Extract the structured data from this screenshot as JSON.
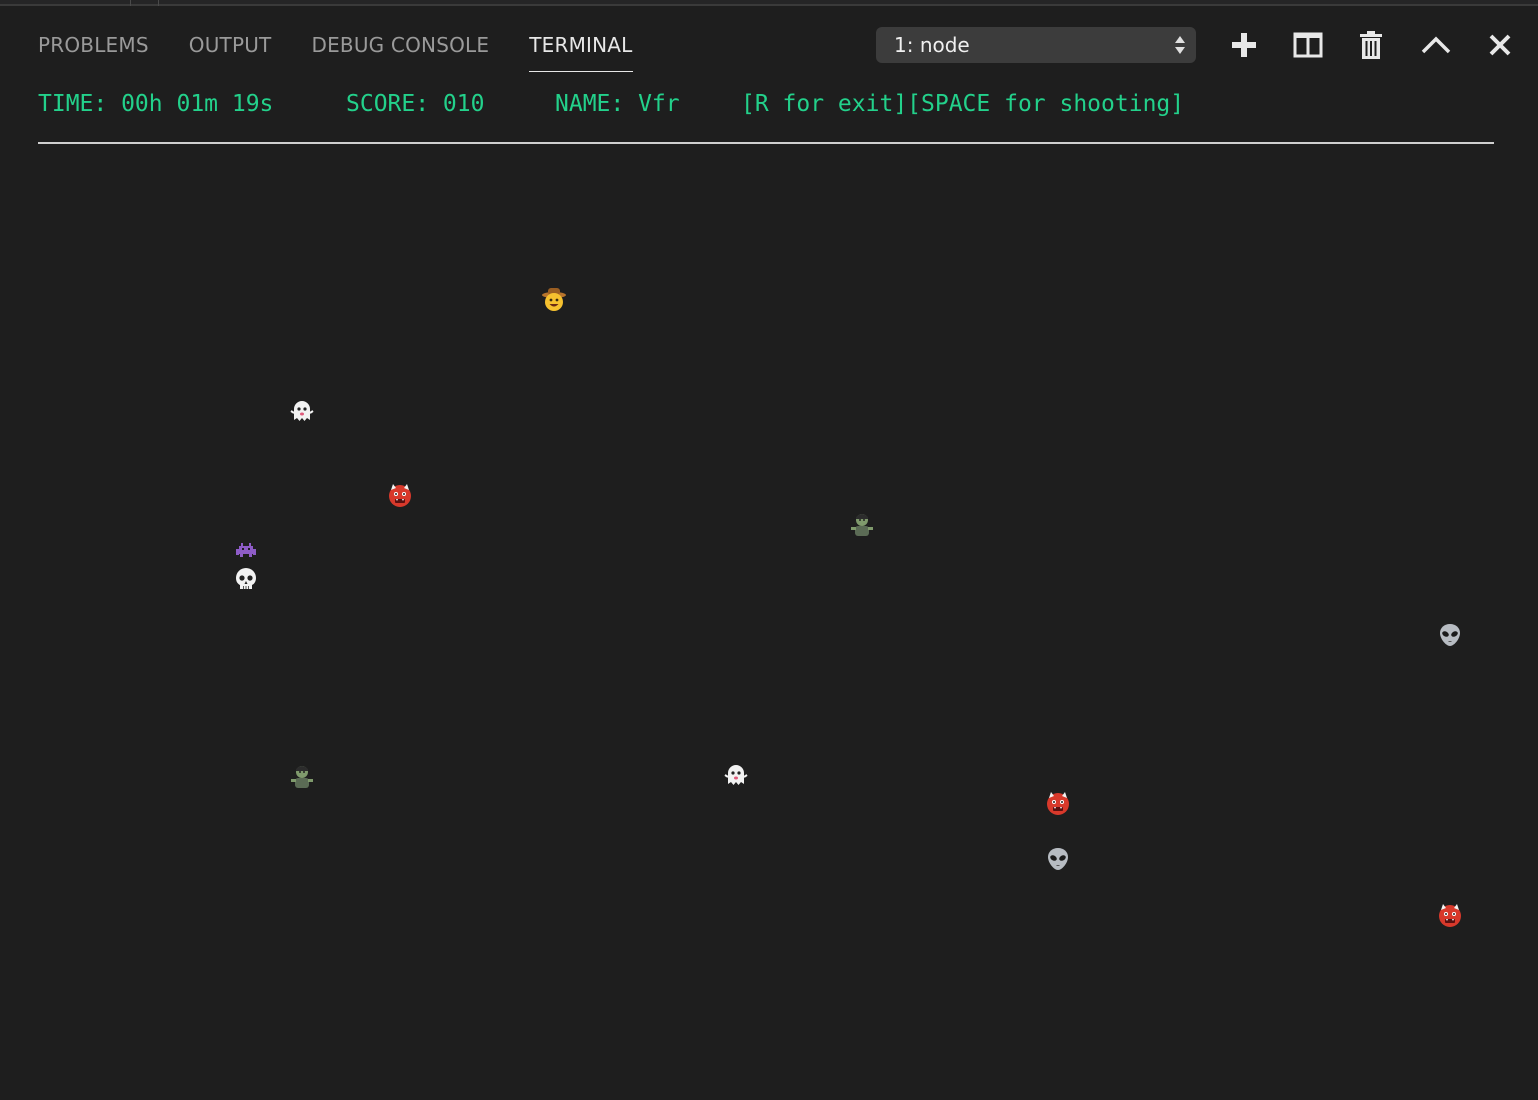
{
  "panel": {
    "tabs": [
      {
        "label": "PROBLEMS"
      },
      {
        "label": "OUTPUT"
      },
      {
        "label": "DEBUG CONSOLE"
      },
      {
        "label": "TERMINAL",
        "active": true
      }
    ],
    "terminal_select": {
      "value": "1: node"
    },
    "actions": [
      "new-terminal",
      "split-terminal",
      "kill-terminal",
      "maximize-panel",
      "close-panel"
    ]
  },
  "game": {
    "time": "TIME: 00h 01m 19s",
    "score": "SCORE: 010",
    "name": "NAME: Vfr",
    "help": "[R for exit][SPACE for shooting]",
    "player": "cowboy-face",
    "enemies": [
      "ghost",
      "ogre",
      "space-invader",
      "skull",
      "zombie",
      "alien",
      "zombie",
      "ghost",
      "ogre",
      "alien",
      "ogre"
    ]
  },
  "colors": {
    "terminal_text": "#23d18b",
    "background": "#1e1e1e",
    "active_tab": "#e7e7e7",
    "inactive_tab": "#9a9a9a"
  }
}
